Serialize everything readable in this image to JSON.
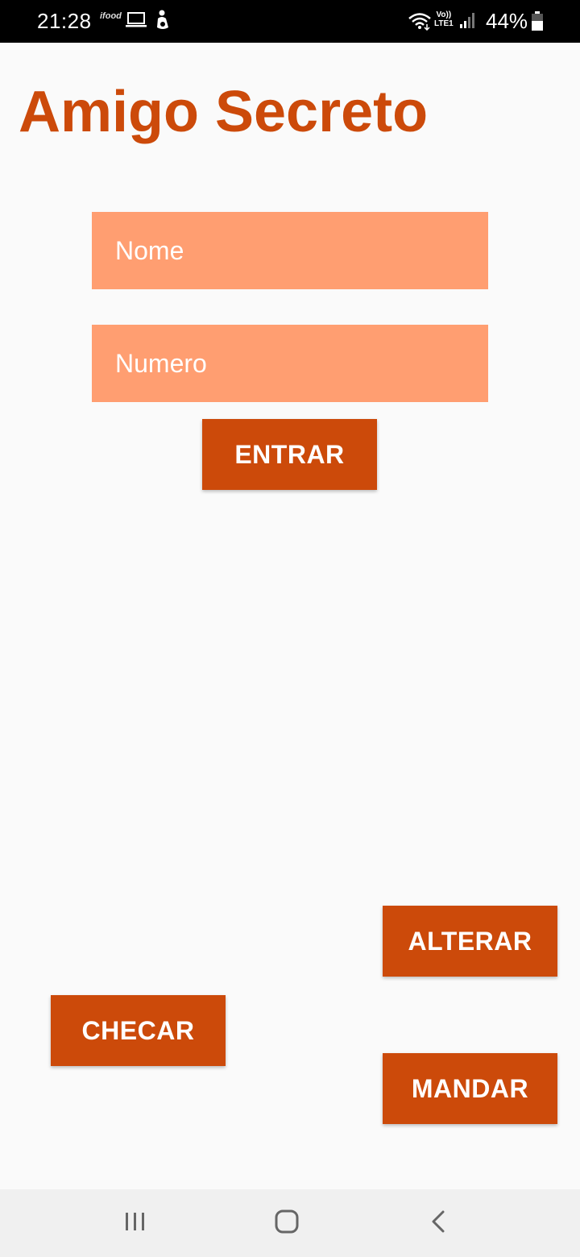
{
  "status_bar": {
    "time": "21:28",
    "ifood_label": "ifood",
    "volte_top": "Vo))",
    "volte_bottom": "LTE1",
    "battery_percent": "44%",
    "icons": [
      "ifood-icon",
      "laptop-icon",
      "person-icon",
      "wifi-icon",
      "volte-icon",
      "signal-icon",
      "battery-icon"
    ]
  },
  "app": {
    "title": "Amigo Secreto",
    "accent_color": "#cc4a0a",
    "field_color": "#ff9e71"
  },
  "form": {
    "name_placeholder": "Nome",
    "number_placeholder": "Numero",
    "enter_label": "ENTRAR"
  },
  "actions": {
    "alter_label": "ALTERAR",
    "check_label": "CHECAR",
    "send_label": "MANDAR"
  },
  "nav_bar": {
    "icons": [
      "recent-apps-icon",
      "home-icon",
      "back-icon"
    ]
  }
}
